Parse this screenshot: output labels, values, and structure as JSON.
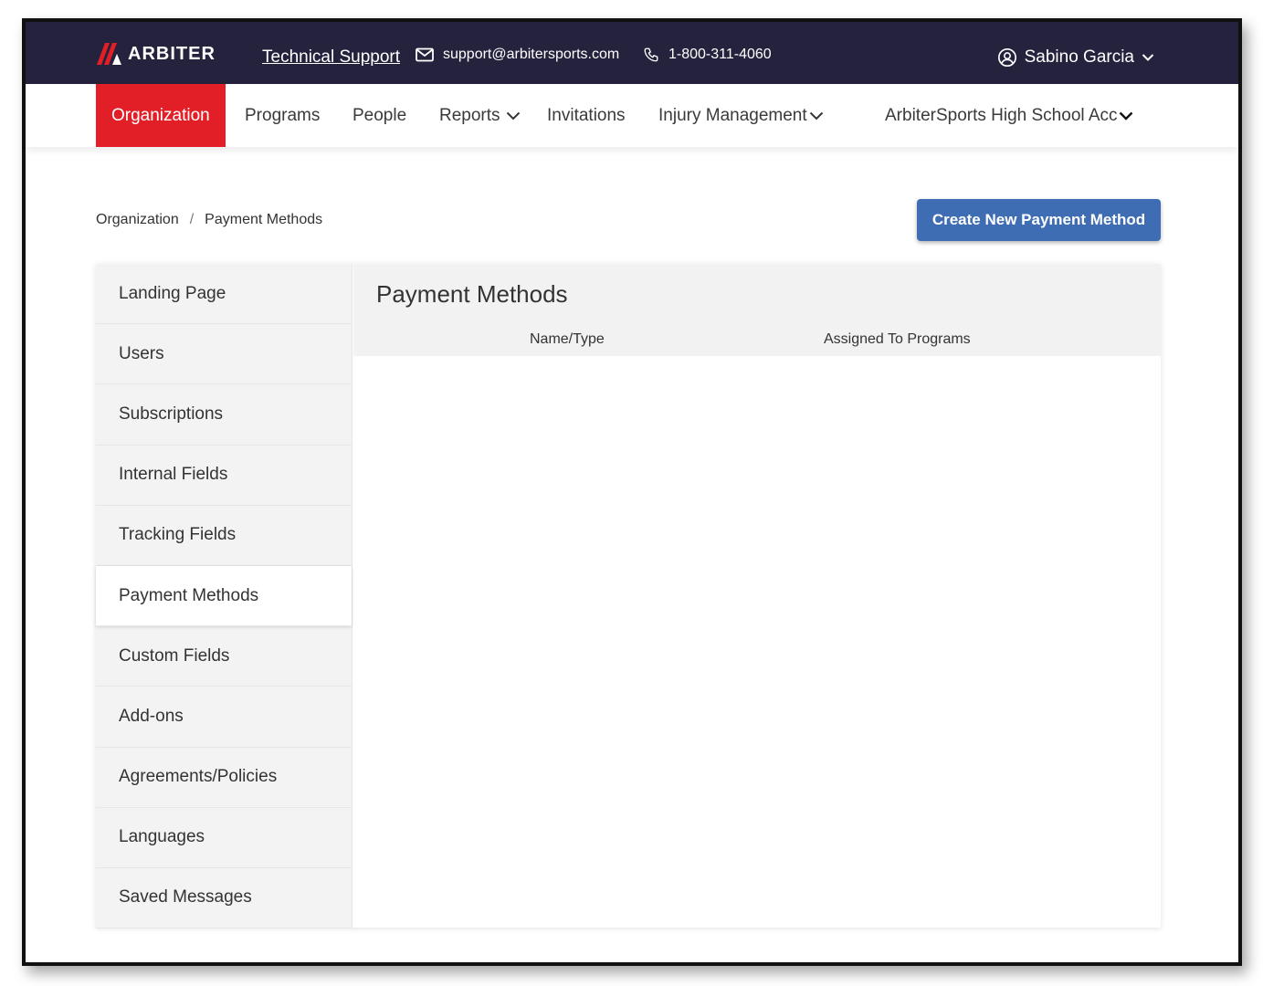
{
  "header": {
    "logo_text": "ARBITER",
    "support_link": "Technical Support",
    "email": "support@arbitersports.com",
    "phone": "1-800-311-4060",
    "user_name": "Sabino Garcia"
  },
  "nav": {
    "items": [
      {
        "label": "Organization",
        "active": true
      },
      {
        "label": "Programs"
      },
      {
        "label": "People"
      },
      {
        "label": "Reports",
        "dropdown": true
      },
      {
        "label": "Invitations"
      },
      {
        "label": "Injury Management",
        "dropdown": true
      },
      {
        "label": "ArbiterSports High School Acc",
        "dropdown": true
      }
    ]
  },
  "breadcrumb": {
    "root": "Organization",
    "separator": "/",
    "current": "Payment Methods"
  },
  "actions": {
    "create_label": "Create New Payment Method"
  },
  "sidebar": {
    "items": [
      {
        "label": "Landing Page"
      },
      {
        "label": "Users"
      },
      {
        "label": "Subscriptions"
      },
      {
        "label": "Internal Fields"
      },
      {
        "label": "Tracking Fields"
      },
      {
        "label": "Payment Methods",
        "active": true
      },
      {
        "label": "Custom Fields"
      },
      {
        "label": "Add-ons"
      },
      {
        "label": "Agreements/Policies"
      },
      {
        "label": "Languages"
      },
      {
        "label": "Saved Messages"
      }
    ]
  },
  "main": {
    "title": "Payment Methods",
    "columns": [
      "Name/Type",
      "Assigned To Programs"
    ]
  },
  "colors": {
    "topbar": "#25223e",
    "active_nav": "#e21f26",
    "primary_button": "#3f6db3"
  }
}
